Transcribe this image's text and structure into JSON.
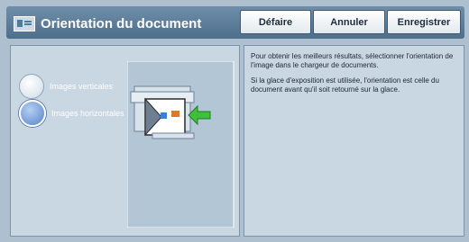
{
  "header": {
    "title": "Orientation du document",
    "buttons": {
      "undo": "Défaire",
      "cancel": "Annuler",
      "save": "Enregistrer"
    }
  },
  "options": [
    {
      "label": "Images verticales",
      "selected": false
    },
    {
      "label": "Images horizontales",
      "selected": true
    }
  ],
  "info": {
    "paragraph1": "Pour obtenir les meilleurs résultats, sélectionner l'orientation de l'image dans le chargeur de documents.",
    "paragraph2": "Si la glace d'exposition est utilisée, l'orientation est celle du document avant qu'il soit retourné sur la glace."
  },
  "icons": {
    "title": "document-orientation-icon",
    "arrow": "green-arrow-icon"
  },
  "colors": {
    "header": "#5a7a96",
    "panel": "#c9d7e3",
    "selected_radio": "#7399d6",
    "arrow": "#3cc43c"
  }
}
